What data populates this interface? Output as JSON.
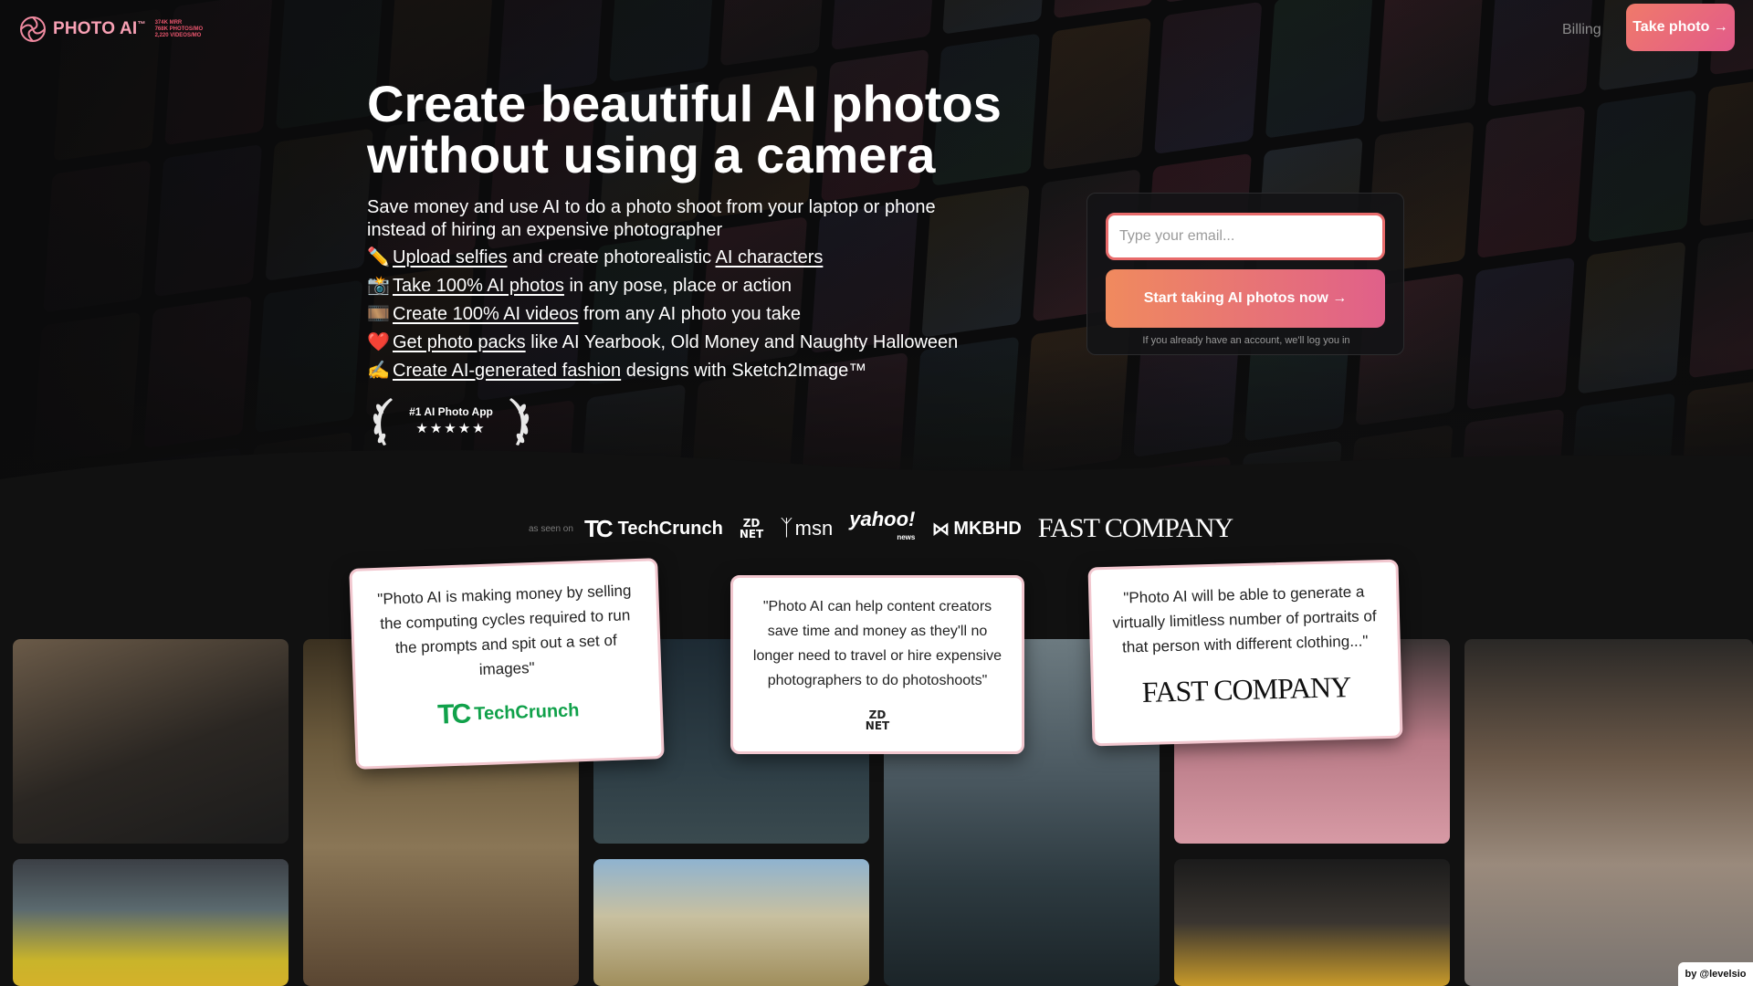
{
  "header": {
    "logo_text": "PHOTO AI",
    "logo_tm": "™",
    "logo_stats": [
      "374K MRR",
      "768K PHOTOS/MO",
      "2,220 VIDEOS/MO"
    ],
    "billing_label": "Billing",
    "take_photo_label": "Take photo →"
  },
  "hero": {
    "title": "Create beautiful AI photos without using a camera",
    "subtitle": "Save money and use AI to do a photo shoot from your laptop or phone instead of hiring an expensive photographer",
    "features": [
      {
        "emoji": "✏️",
        "link1": "Upload selfies",
        "text1": " and create photorealistic ",
        "link2": "AI characters",
        "text2": ""
      },
      {
        "emoji": "📸",
        "link1": "Take 100% AI photos",
        "text1": " in any pose, place or action",
        "link2": "",
        "text2": ""
      },
      {
        "emoji": "🎞️",
        "link1": "Create 100% AI videos",
        "text1": " from any AI photo you take",
        "link2": "",
        "text2": ""
      },
      {
        "emoji": "❤️",
        "link1": "Get photo packs",
        "text1": " like AI Yearbook, Old Money and Naughty Halloween",
        "link2": "",
        "text2": ""
      },
      {
        "emoji": "✍️",
        "link1": "Create AI-generated fashion",
        "text1": " designs with Sketch2Image™",
        "link2": "",
        "text2": ""
      }
    ],
    "award_title": "#1 AI Photo App",
    "award_stars": "★★★★★"
  },
  "signup": {
    "email_placeholder": "Type your email...",
    "cta_label": "Start taking AI photos now →",
    "note": "If you already have an account, we'll log you in"
  },
  "press": {
    "label": "as seen on",
    "techcrunch": "TechCrunch",
    "zdnet_top": "ZD",
    "zdnet_bottom": "NET",
    "msn": "msn",
    "yahoo": "yahoo!",
    "yahoo_sub": "news",
    "mkbhd": "MKBHD",
    "fastcompany": "FAST COMPANY"
  },
  "quotes": [
    {
      "text": "\"Photo AI is making money by selling the computing cycles required to run the prompts and spit out a set of images\"",
      "source": "TechCrunch"
    },
    {
      "text": "\"Photo AI can help content creators save time and money as they'll no longer need to travel or hire expensive photographers to do photoshoots\"",
      "source_top": "ZD",
      "source_bottom": "NET"
    },
    {
      "text": "\"Photo AI will be able to generate a virtually limitless number of portraits of that person with different clothing...\"",
      "source": "FAST COMPANY"
    }
  ],
  "byline": "by @levelsio",
  "colors": {
    "accent_start": "#f08a5e",
    "accent_end": "#e0608a",
    "logo": "#f8a0b4",
    "quote_border": "#f2c7cf",
    "techcrunch_green": "#10a14a"
  }
}
